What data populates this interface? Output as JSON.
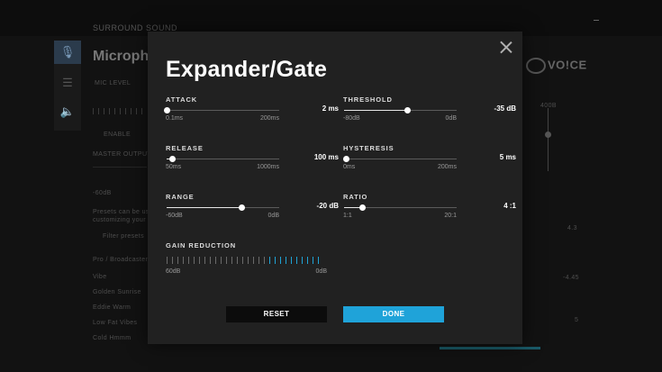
{
  "background": {
    "top_label": "SURROUND SOUND",
    "panel_title": "Microphone",
    "mic_level_label": "MIC LEVEL",
    "enable_label": "ENABLE",
    "master_output_label": "MASTER OUTPUT",
    "master_output_value": "-60dB",
    "presets_text_1": "Presets can be used",
    "presets_text_2": "customizing your",
    "filter_placeholder": "Filter presets",
    "preset_category": "Pro / Broadcaster",
    "preset_items": [
      "Vibe",
      "Golden Sunrise",
      "Eddie Warm",
      "Low Fat Vibes",
      "Cold Hmmm"
    ],
    "right_logo": "VO!CE",
    "right_db": "400B",
    "right_db2": "4.3",
    "right_db3": "-4.45",
    "right_db4": "5"
  },
  "modal": {
    "title": "Expander/Gate",
    "close_icon": "close-icon",
    "controls": {
      "attack": {
        "label": "ATTACK",
        "value": "2 ms",
        "min": "0.1ms",
        "max": "200ms",
        "level": 0.0
      },
      "threshold": {
        "label": "THRESHOLD",
        "value": "-35 dB",
        "min": "-80dB",
        "max": "0dB",
        "level": 0.56
      },
      "release": {
        "label": "RELEASE",
        "value": "100 ms",
        "min": "50ms",
        "max": "1000ms",
        "level": 0.05
      },
      "hysteresis": {
        "label": "HYSTERESIS",
        "value": "5 ms",
        "min": "0ms",
        "max": "200ms",
        "level": 0.02
      },
      "range": {
        "label": "RANGE",
        "value": "-20 dB",
        "min": "-60dB",
        "max": "0dB",
        "level": 0.67
      },
      "ratio": {
        "label": "RATIO",
        "value": "4 :1",
        "min": "1:1",
        "max": "20:1",
        "level": 0.16
      }
    },
    "gain_reduction": {
      "label": "GAIN REDUCTION",
      "min": "60dB",
      "max": "0dB",
      "total_segments": 29,
      "active_segments": 10
    },
    "buttons": {
      "reset": "RESET",
      "done": "DONE"
    },
    "colors": {
      "accent": "#1fa3d9",
      "modal_bg": "#212121"
    }
  }
}
